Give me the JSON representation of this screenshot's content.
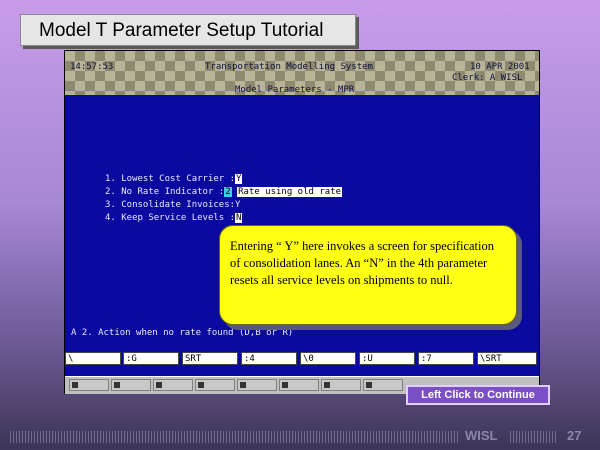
{
  "slide": {
    "title": "Model T Parameter Setup Tutorial",
    "continue_button": "Left Click to Continue",
    "footer_brand": "WISL",
    "page_number": "27"
  },
  "terminal": {
    "time": "14:57:53",
    "system_name": "Transportation Modelling System",
    "date": "10 APR 2001",
    "clerk": "Clerk: A WISL",
    "screen_title": "Model Parameters - MPR",
    "params": [
      {
        "label": "1. Lowest Cost Carrier :",
        "value": "Y"
      },
      {
        "label": "2. No Rate Indicator   :",
        "value": "2",
        "note": "Rate using old rate"
      },
      {
        "label": "3. Consolidate Invoices:",
        "value": "Y"
      },
      {
        "label": "4. Keep Service Levels :",
        "value": "N"
      }
    ],
    "status_line": "A 2. Action when no rate found (D,B or R)",
    "function_keys": [
      "\\",
      ":G",
      "SRT",
      ":4",
      "\\0",
      ":U",
      ":7",
      "\\SRT"
    ]
  },
  "callout": {
    "text": "Entering “ Y” here invokes a screen for specification of consolidation lanes. An “N” in the 4th parameter resets all service levels on shipments to null."
  },
  "colors": {
    "terminal_bg": "#0a0aa0",
    "callout_bg": "#ffff14",
    "continue_bg": "#7b4fc6"
  }
}
